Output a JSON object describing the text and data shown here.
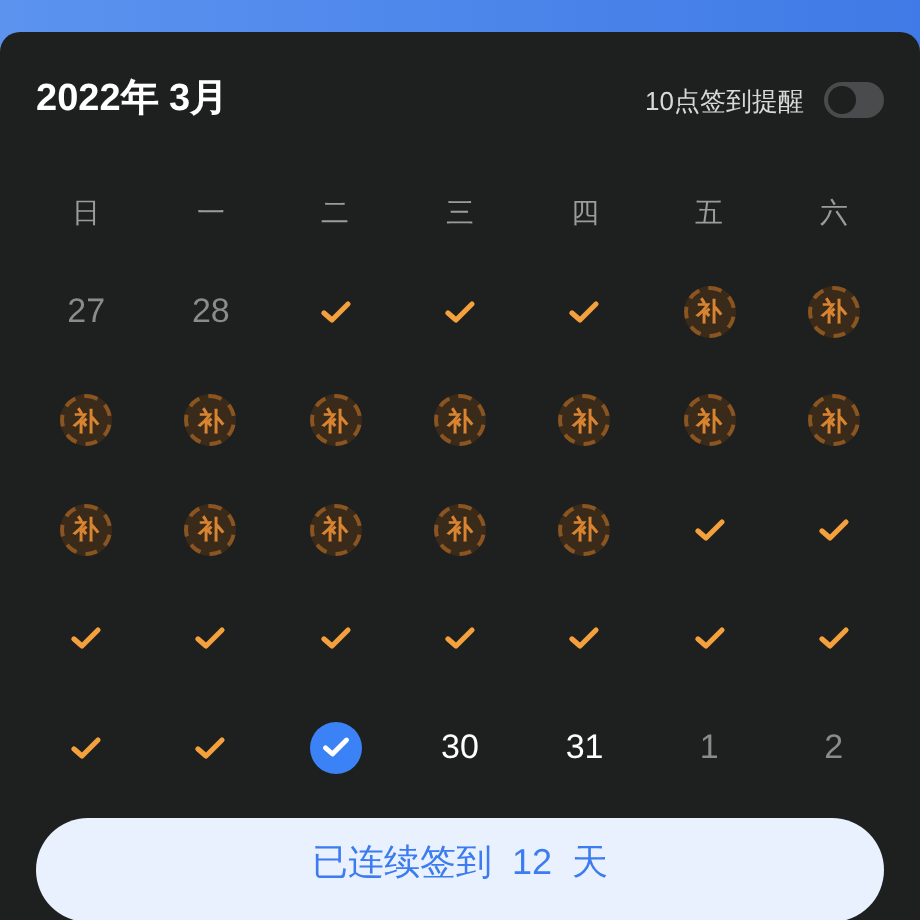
{
  "header": {
    "title": "2022年 3月",
    "reminder_label": "10点签到提醒",
    "reminder_on": false
  },
  "weekdays": [
    "日",
    "一",
    "二",
    "三",
    "四",
    "五",
    "六"
  ],
  "days": [
    {
      "kind": "date",
      "text": "27",
      "muted": true
    },
    {
      "kind": "date",
      "text": "28",
      "muted": true
    },
    {
      "kind": "signed"
    },
    {
      "kind": "signed"
    },
    {
      "kind": "signed"
    },
    {
      "kind": "makeup",
      "text": "补"
    },
    {
      "kind": "makeup",
      "text": "补"
    },
    {
      "kind": "makeup",
      "text": "补"
    },
    {
      "kind": "makeup",
      "text": "补"
    },
    {
      "kind": "makeup",
      "text": "补"
    },
    {
      "kind": "makeup",
      "text": "补"
    },
    {
      "kind": "makeup",
      "text": "补"
    },
    {
      "kind": "makeup",
      "text": "补"
    },
    {
      "kind": "makeup",
      "text": "补"
    },
    {
      "kind": "makeup",
      "text": "补"
    },
    {
      "kind": "makeup",
      "text": "补"
    },
    {
      "kind": "makeup",
      "text": "补"
    },
    {
      "kind": "makeup",
      "text": "补"
    },
    {
      "kind": "makeup",
      "text": "补"
    },
    {
      "kind": "signed"
    },
    {
      "kind": "signed"
    },
    {
      "kind": "signed"
    },
    {
      "kind": "signed"
    },
    {
      "kind": "signed"
    },
    {
      "kind": "signed"
    },
    {
      "kind": "signed"
    },
    {
      "kind": "signed"
    },
    {
      "kind": "signed"
    },
    {
      "kind": "signed"
    },
    {
      "kind": "signed"
    },
    {
      "kind": "today"
    },
    {
      "kind": "date",
      "text": "30",
      "muted": false
    },
    {
      "kind": "date",
      "text": "31",
      "muted": false
    },
    {
      "kind": "date",
      "text": "1",
      "muted": true
    },
    {
      "kind": "date",
      "text": "2",
      "muted": true
    }
  ],
  "streak_button": "已连续签到  12  天"
}
